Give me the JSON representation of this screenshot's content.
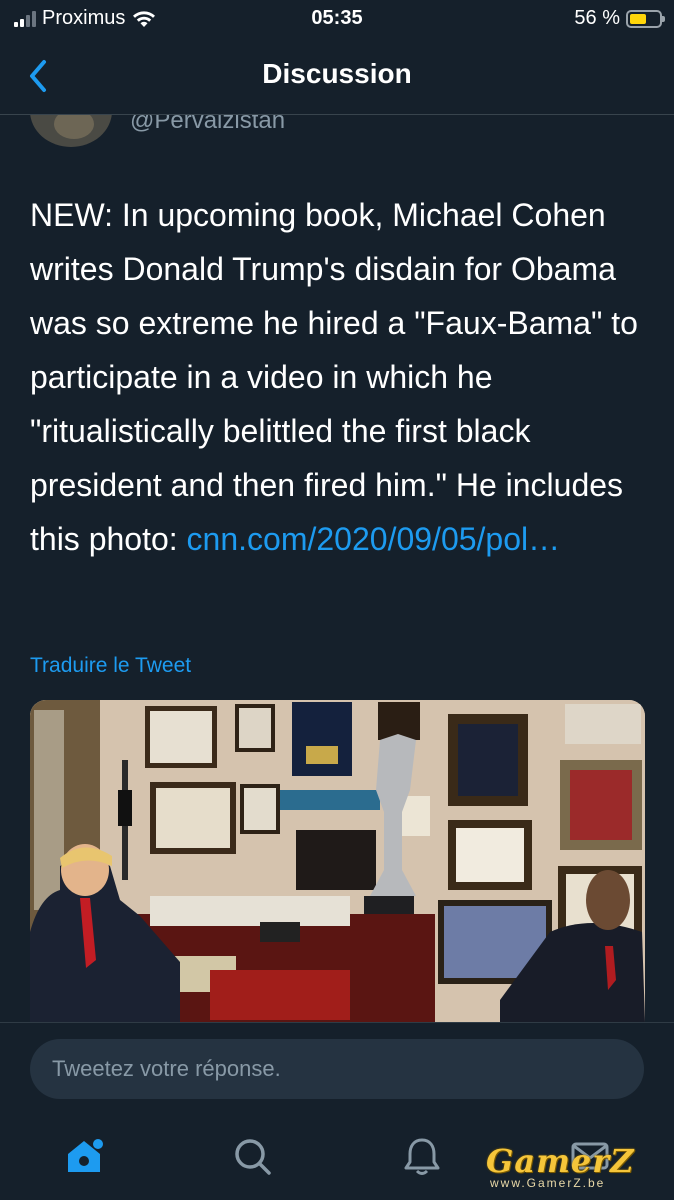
{
  "status_bar": {
    "carrier": "Proximus",
    "time": "05:35",
    "battery": "56 %",
    "battery_level": 0.56
  },
  "nav": {
    "title": "Discussion",
    "back_icon": "chevron-left-icon"
  },
  "tweet": {
    "handle": "@Pervaizistan",
    "text_plain": "NEW: In upcoming book, Michael Cohen writes Donald Trump's disdain for Obama was so extreme he hired a \"Faux-Bama\" to participate in a video in which he \"ritualistically belittled the first black president and then fired him.\" He includes this photo: ",
    "link_text": "cnn.com/2020/09/05/pol…",
    "translate_label": "Traduire le Tweet"
  },
  "reply": {
    "placeholder": "Tweetez votre réponse."
  },
  "tabs": [
    {
      "name": "home",
      "icon": "home-icon",
      "active": true
    },
    {
      "name": "search",
      "icon": "search-icon",
      "active": false
    },
    {
      "name": "notifications",
      "icon": "bell-icon",
      "active": false
    },
    {
      "name": "messages",
      "icon": "mail-icon",
      "active": false
    }
  ],
  "watermark": {
    "brand": "GamerZ",
    "url": "www.GamerZ.be"
  },
  "colors": {
    "background": "#15202b",
    "accent": "#1d9bf0",
    "secondary_text": "#8899a6"
  }
}
